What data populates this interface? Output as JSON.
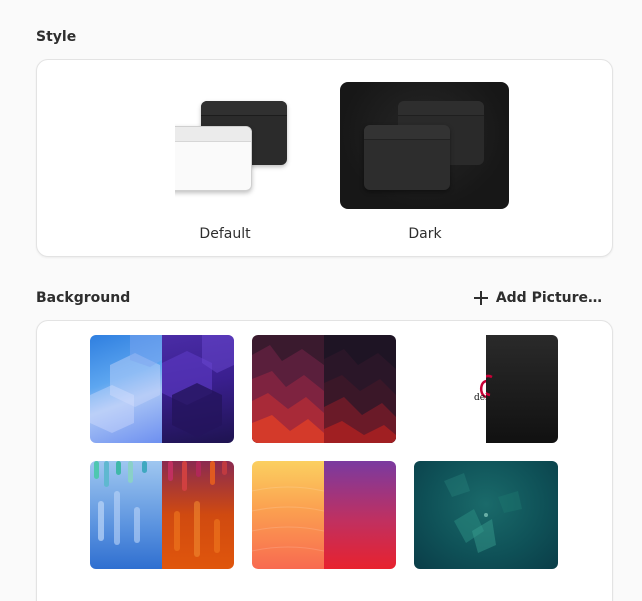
{
  "style": {
    "title": "Style",
    "options": [
      {
        "label": "Default"
      },
      {
        "label": "Dark"
      }
    ]
  },
  "background": {
    "title": "Background",
    "add_label": "Add Picture…",
    "debian_text": "debian"
  },
  "colors": {
    "accent": "#3584e4",
    "page_bg": "#fafafa",
    "card_bg": "#ffffff",
    "dark_window": "#2b2b2b"
  }
}
